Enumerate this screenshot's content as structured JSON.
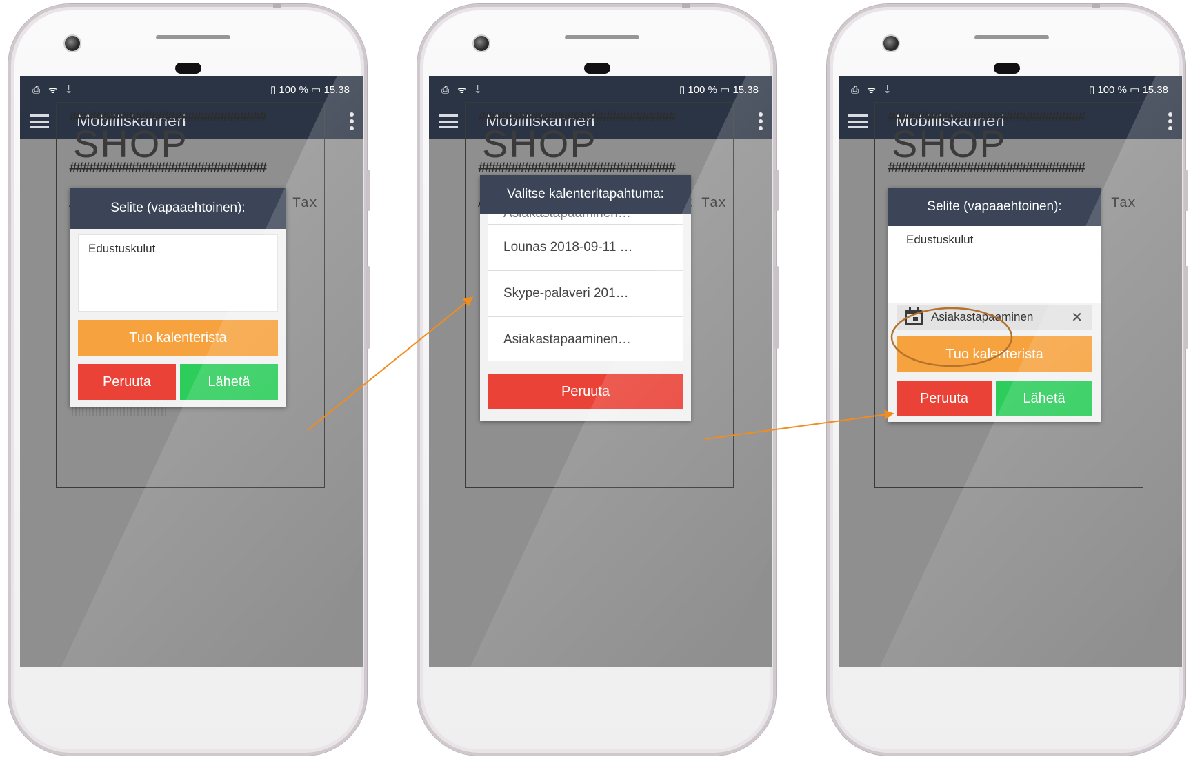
{
  "status": {
    "icons_left": "⎙ ᯤ ⏚",
    "battery": "100 %",
    "time": "15.38"
  },
  "app": {
    "title": "Mobiiliskanneri"
  },
  "receipt": {
    "hash": "##############################",
    "shop": "SHOP",
    "header": "Article       Count Amount Tax"
  },
  "screens": [
    {
      "dialog_title": "Selite (vapaaehtoinen):",
      "description_value": "Edustuskulut",
      "import_button": "Tuo kalenterista",
      "cancel_button": "Peruuta",
      "send_button": "Lähetä"
    },
    {
      "dialog_title": "Valitse kalenteritapahtuma:",
      "events": [
        "Asiakastapaaminen…",
        "Lounas 2018-09-11 …",
        "Skype-palaveri 201…",
        "Asiakastapaaminen…"
      ],
      "cancel_button": "Peruuta"
    },
    {
      "dialog_title": "Selite (vapaaehtoinen):",
      "description_value": "Edustuskulut",
      "selected_event": "Asiakastapaaminen",
      "remove_icon": "close-icon",
      "import_button": "Tuo kalenterista",
      "cancel_button": "Peruuta",
      "send_button": "Lähetä"
    }
  ],
  "colors": {
    "header": "#2b3444",
    "orange": "#f6a23e",
    "red": "#ea4237",
    "green": "#2ccd5b",
    "annotation": "#f28c1c",
    "highlight_ring": "#b3722e"
  }
}
